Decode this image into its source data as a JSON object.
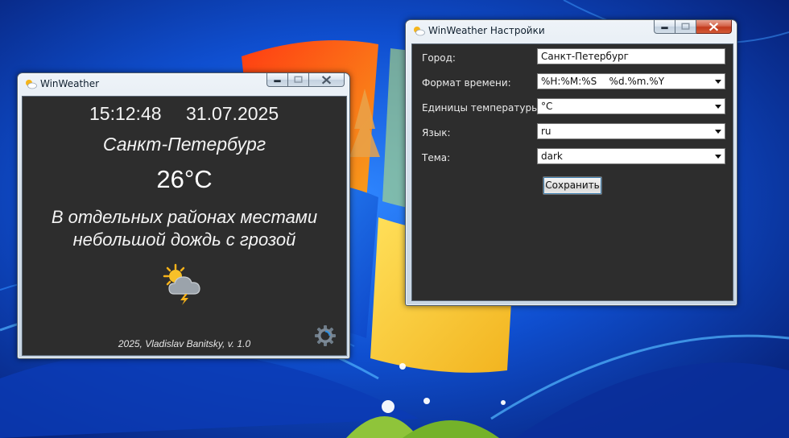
{
  "desktop": {
    "wallpaper": "windows-7-harmony",
    "colors": {
      "sky_dark": "#071a6b",
      "sky_light": "#1b6cf0",
      "flag_orange": "#f2681b",
      "flag_yellow": "#f7d23a"
    }
  },
  "weather_window": {
    "title": "WinWeather",
    "time": "15:12:48",
    "date": "31.07.2025",
    "city": "Санкт-Петербург",
    "temperature": "26°C",
    "description_line1": "В отдельных районах местами",
    "description_line2": "небольшой дождь с грозой",
    "weather_icon": "sun-cloud-lightning-icon",
    "footer": "2025, Vladislav Banitsky, v. 1.0",
    "settings_icon": "gear-icon",
    "colors": {
      "background": "#2d2d2d",
      "text": "#f4f4f4"
    }
  },
  "settings_window": {
    "title": "WinWeather Настройки",
    "fields": {
      "city": {
        "label": "Город:",
        "value": "Санкт-Петербург"
      },
      "time_format": {
        "label": "Формат времени:",
        "value": "%H:%M:%S    %d.%m.%Y"
      },
      "temp_units": {
        "label": "Единицы температуры:",
        "value": "°C"
      },
      "language": {
        "label": "Язык:",
        "value": "ru"
      },
      "theme": {
        "label": "Тема:",
        "value": "dark"
      }
    },
    "save_label": "Сохранить"
  }
}
